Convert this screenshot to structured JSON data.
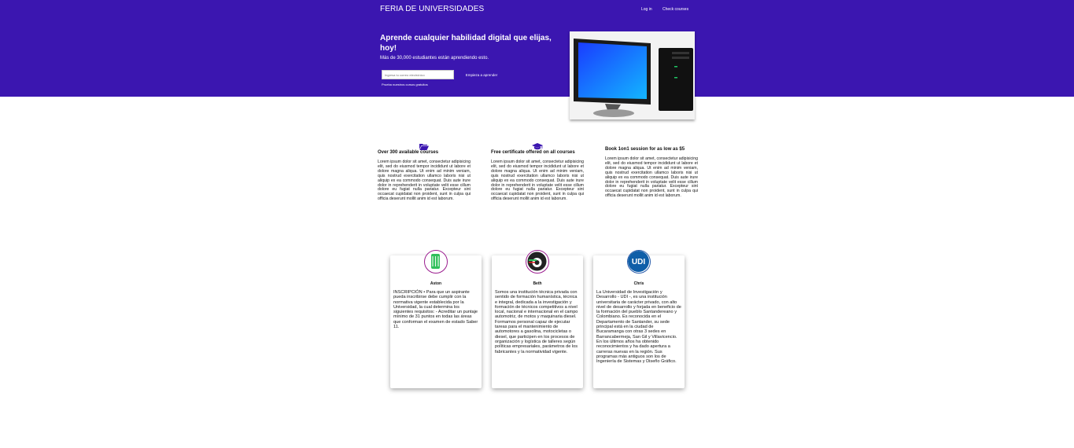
{
  "header": {
    "brand": "FERIA DE UNIVERSIDADES",
    "nav": {
      "login": "Log in",
      "courses": "Check courses"
    }
  },
  "hero": {
    "title": "Aprende cualquier habilidad digital que elijas, hoy!",
    "subtitle": "Más de 30,000 estudiantes están aprendiendo esto.",
    "email_placeholder": "Ingresa tu correo electrónico",
    "start_label": "Empieza a aprender",
    "free_link": "Prueba nuestros cursos gratuitos"
  },
  "features": [
    {
      "icon": "folder-icon",
      "title": "Over 300 available courses",
      "text": "Lorem ipsum dolor sit amet, consectetur adipisicing elit, sed do eiusmod tempor incididunt ut labore et dolore magna aliqua. Ut enim ad minim veniam, quis nostrud exercitation ullamco laboris nisi ut aliquip ex ea commodo consequat. Duis aute irure dolor in reprehenderit in voluptate velit esse cillum dolore eu fugiat nulla pariatur. Excepteur sint occaecat cupidatat non proident, sunt in culpa qui officia deserunt mollit anim id est laborum."
    },
    {
      "icon": "graduation-cap-icon",
      "title": "Free certificate offered on all courses",
      "text": "Lorem ipsum dolor sit amet, consectetur adipisicing elit, sed do eiusmod tempor incididunt ut labore et dolore magna aliqua. Ut enim ad minim veniam, quis nostrud exercitation ullamco laboris nisi ut aliquip ex ea commodo consequat. Duis aute irure dolor in reprehenderit in voluptate velit esse cillum dolore eu fugiat nulla pariatur. Excepteur sint occaecat cupidatat non proident, sunt in culpa qui officia deserunt mollit anim id est laborum."
    },
    {
      "icon": "",
      "title": "Book 1on1 session for as low as $5",
      "text": "Lorem ipsum dolor sit amet, consectetur adipisicing elit, sed do eiusmod tempor incididunt ut labore et dolore magna aliqua. Ut enim ad minim veniam, quis nostrud exercitation ullamco laboris nisi ut aliquip ex ea commodo consequat. Duis aute irure dolor in reprehenderit in voluptate velit esse cillum dolore eu fugiat nulla pariatur. Excepteur sint occaecat cupidatat non proident, sunt in culpa qui officia deserunt mollit anim id est laborum."
    }
  ],
  "cards": [
    {
      "name": "Aston",
      "avatar": "university-logo-green",
      "text": "INSCRIPCIÓN • Para que un aspirante pueda inscribirse debe cumplir con la normativa vigente establecida por la Universidad, la cual determina los siguientes requisitos: - Acreditar un puntaje mínimo de 31 puntos en todas las áreas que conforman el examen de estado Saber 11."
    },
    {
      "name": "Beth",
      "avatar": "technical-school-logo",
      "text": "Somos una institución técnica privada con sentido de formación humanística, técnica e integral, dedicada a la investigación y formación de técnicos competitivos a nivel local, nacional e internacional en el campo automotriz, de motos y maquinaria diesel. Formamos personal capaz de ejecutar tareas para el mantenimiento de automotores a gasolina, motocicletas o diesel, que participen en los procesos de organización y logística de talleres según políticas empresariales, parámetros de los fabricantes y la normatividad vigente."
    },
    {
      "name": "Chris",
      "avatar": "udi-logo",
      "avatar_text": "UDI",
      "text": "La Universidad de Investigación y Desarrollo - UDI -, es una institución universitaria de carácter privado, con alto nivel de desarrollo y forjada en beneficio de la formación del pueblo Santandereano y Colombiano. Es reconocida en el Departamento de Santander, su sede principal está en la ciudad de Bucaramanga con otras 3 sedes en Barrancabermeja, San Gil y Villavicencio. En los últimos años ha obtenido reconocimientos y ha dado apertura a carreras nuevas en la región. Sus programas más antiguos son los de Ingeniería de Sistemas y Diseño Gráfico."
    }
  ],
  "colors": {
    "brand": "#3b16b0",
    "avatar_border": "#9b1d8f"
  }
}
